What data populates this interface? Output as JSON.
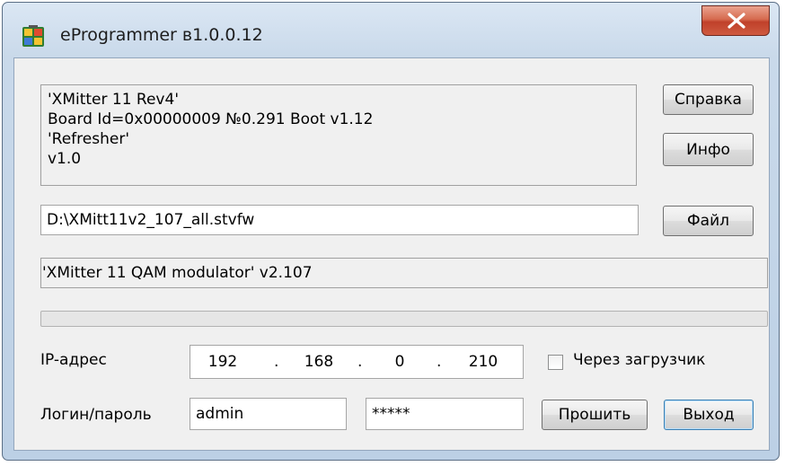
{
  "window": {
    "title": "eProgrammer в1.0.0.12"
  },
  "device_info": {
    "lines": [
      "'XMitter 11 Rev4'",
      "Board Id=0x00000009 №0.291 Boot v1.12",
      "'Refresher'",
      "v1.0"
    ]
  },
  "buttons": {
    "help": "Справка",
    "info": "Инфо",
    "file": "Файл",
    "flash": "Прошить",
    "exit": "Выход"
  },
  "file": {
    "path": "D:\\XMitt11v2_107_all.stvfw"
  },
  "firmware": {
    "description": "'XMitter 11 QAM modulator' v2.107"
  },
  "progress": {
    "value": 0
  },
  "network": {
    "ip_label": "IP-адрес",
    "ip_octets": [
      "192",
      "168",
      "0",
      "210"
    ],
    "via_bootloader_label": "Через загрузчик",
    "via_bootloader_checked": false
  },
  "credentials": {
    "label": "Логин/пароль",
    "login": "admin",
    "password": "*****"
  }
}
